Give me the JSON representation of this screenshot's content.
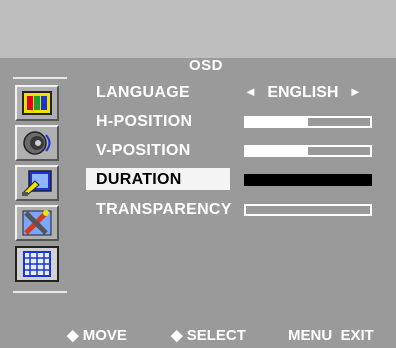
{
  "osd": {
    "title": "OSD",
    "sidebar": [
      {
        "icon": "color-bars-icon",
        "selected": false
      },
      {
        "icon": "speaker-icon",
        "selected": false
      },
      {
        "icon": "image-adjust-icon",
        "selected": false
      },
      {
        "icon": "tools-icon",
        "selected": false
      },
      {
        "icon": "osd-grid-icon",
        "selected": true
      }
    ],
    "menu": {
      "language": {
        "label": "LANGUAGE",
        "value": "ENGLISH",
        "left_arrow": "◄",
        "right_arrow": "►"
      },
      "h_position": {
        "label": "H-POSITION",
        "level": 0.5
      },
      "v_position": {
        "label": "V-POSITION",
        "level": 0.5
      },
      "duration": {
        "label": "DURATION",
        "level": 1.0,
        "highlighted": true
      },
      "transparency": {
        "label": "TRANSPARENCY",
        "level": 0.0
      }
    },
    "footer": {
      "move_icon": "◆",
      "move_label": "MOVE",
      "select_icon": "◆",
      "select_label": "SELECT",
      "menu_exit_label": "MENU  EXIT"
    },
    "colors": {
      "background": "#9a9a9a",
      "top_band": "#bebebe",
      "text": "#ffffff",
      "highlight": "#f4f4f4"
    }
  }
}
